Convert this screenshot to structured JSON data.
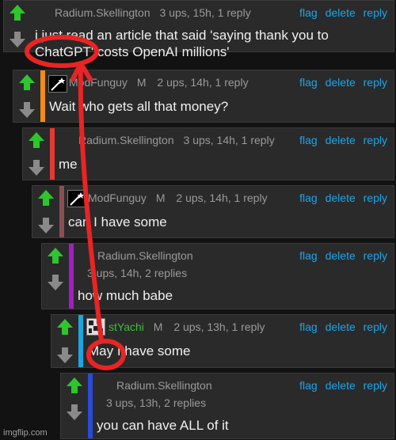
{
  "actions": {
    "flag": "flag",
    "delete": "delete",
    "reply": "reply"
  },
  "comments": [
    {
      "user": "Radium.Skellington",
      "mod": "",
      "meta": "3 ups, 15h, 1 reply",
      "meta2": "",
      "text": "i just read an article that said 'saying thank you to",
      "text2": "ChatGPT' costs OpenAI millions'",
      "bar_color": "",
      "avatar": ""
    },
    {
      "user": "ModFunguy",
      "mod": "M",
      "meta": "2 ups, 14h, 1 reply",
      "meta2": "",
      "text": "Wait who gets all that money?",
      "text2": "",
      "bar_color": "#f28c18",
      "avatar": "star-avatar"
    },
    {
      "user": "Radium.Skellington",
      "mod": "",
      "meta": "3 ups, 14h, 1 reply",
      "meta2": "",
      "text": "me",
      "text2": "",
      "bar_color": "#e53935",
      "avatar": ""
    },
    {
      "user": "ModFunguy",
      "mod": "M",
      "meta": "2 ups, 14h, 1 reply",
      "meta2": "",
      "text": "can I have some",
      "text2": "",
      "bar_color": "#8a5050",
      "avatar": "star-avatar"
    },
    {
      "user": "Radium.Skellington",
      "mod": "",
      "meta": "",
      "meta2": "3 ups, 14h, 2 replies",
      "text": "how much babe",
      "text2": "",
      "bar_color": "#a020c0",
      "avatar": ""
    },
    {
      "user": "stYachi",
      "mod": "M",
      "meta": "2 ups, 13h, 1 reply",
      "meta2": "",
      "text": "May I have some",
      "text2": "",
      "bar_color": "#1aa7e0",
      "avatar": "pixel-avatar"
    },
    {
      "user": "Radium.Skellington",
      "mod": "",
      "meta": "",
      "meta2": "3 ups, 13h, 2 replies",
      "text": "you can have ALL of it",
      "text2": "",
      "bar_color": "#2a4ad8",
      "avatar": ""
    }
  ],
  "watermark": "imgflip.com",
  "colors": {
    "upvote": "#2ec52e",
    "downvote": "#8a8a8a",
    "link": "#1ea5e8",
    "annotation": "#e82424"
  }
}
